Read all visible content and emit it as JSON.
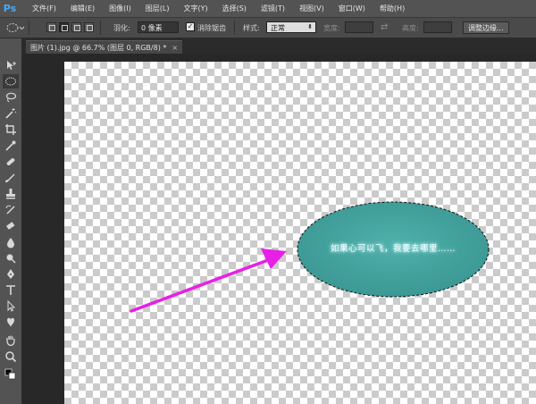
{
  "app": {
    "logo": "Ps"
  },
  "menu": [
    "文件(F)",
    "编辑(E)",
    "图像(I)",
    "图层(L)",
    "文字(Y)",
    "选择(S)",
    "滤镜(T)",
    "视图(V)",
    "窗口(W)",
    "帮助(H)"
  ],
  "options": {
    "feather_label": "羽化:",
    "feather_value": "0 像素",
    "antialias_label": "消除锯齿",
    "antialias_checked": "✓",
    "style_label": "样式:",
    "style_value": "正常",
    "width_label": "宽度:",
    "height_label": "高度:",
    "refine_button": "调整边缘..."
  },
  "document_tab": {
    "title": "图片 (1).jpg @ 66.7% (图层 0, RGB/8) *",
    "close": "×"
  },
  "canvas": {
    "ellipse_text": "如果心可以飞，我要去哪里……",
    "ellipse_color": "#3a9692",
    "arrow_color": "#e81fe6"
  },
  "colors": {
    "menubar_bg": "#535353",
    "toolbar_bg": "#535353",
    "workspace_bg": "#282828",
    "accent_ps": "#4aa8f2"
  },
  "tools": [
    "move-tool",
    "elliptical-marquee-tool",
    "lasso-tool",
    "magic-wand-tool",
    "crop-tool",
    "eyedropper-tool",
    "spot-healing-tool",
    "brush-tool",
    "clone-stamp-tool",
    "history-brush-tool",
    "eraser-tool",
    "paint-bucket-tool",
    "blur-tool",
    "dodge-tool",
    "pen-tool",
    "type-tool",
    "path-selection-tool",
    "custom-shape-tool",
    "hand-tool",
    "zoom-tool"
  ]
}
